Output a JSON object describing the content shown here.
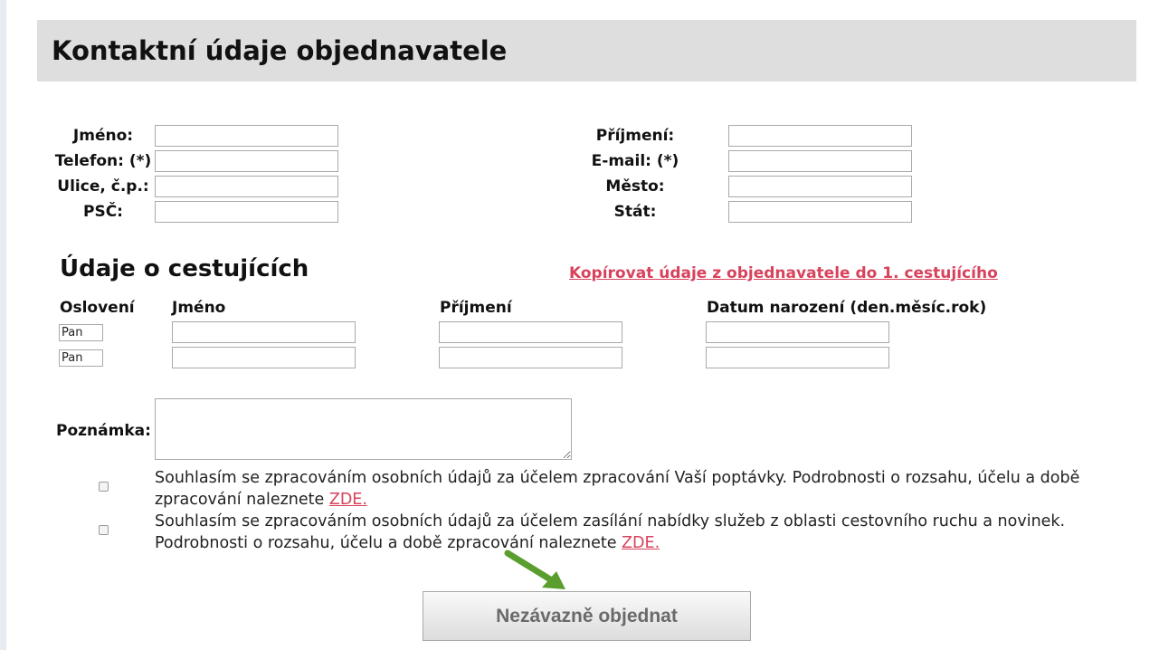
{
  "header": {
    "title": "Kontaktní údaje objednavatele"
  },
  "contact": {
    "first_name_label": "Jméno:",
    "last_name_label": "Příjmení:",
    "phone_label": "Telefon: (*)",
    "email_label": "E-mail: (*)",
    "street_label": "Ulice, č.p.:",
    "city_label": "Město:",
    "zip_label": "PSČ:",
    "country_label": "Stát:"
  },
  "travelers": {
    "title": "Údaje o cestujících",
    "copy_link": "Kopírovat údaje z objednavatele do 1. cestujícího",
    "col_salutation": "Oslovení",
    "col_first_name": "Jméno",
    "col_last_name": "Příjmení",
    "col_birthdate": "Datum narození (den.měsíc.rok)",
    "rows": [
      {
        "salutation": "Pan"
      },
      {
        "salutation": "Pan"
      }
    ]
  },
  "note": {
    "label": "Poznámka:"
  },
  "consents": [
    {
      "text": "Souhlasím se zpracováním osobních údajů za účelem zpracování Vaší poptávky. Podrobnosti o rozsahu, účelu a době zpracování naleznete ",
      "link": "ZDE."
    },
    {
      "text": "Souhlasím se zpracováním osobních údajů za účelem zasílání nabídky služeb z oblasti cestovního ruchu a novinek. Podrobnosti o rozsahu, účelu a době zpracování naleznete ",
      "link": "ZDE."
    }
  ],
  "submit": {
    "label": "Nezávazně objednat"
  },
  "colors": {
    "link": "#d8425c",
    "header_bg": "#dedede",
    "arrow": "#5a9e2f"
  },
  "icons": {
    "arrow": "arrow-pointer-icon"
  }
}
